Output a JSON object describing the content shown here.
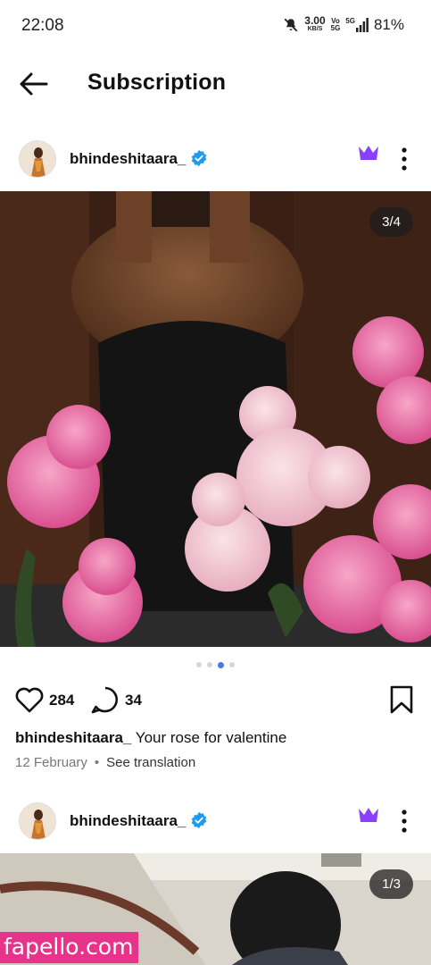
{
  "status_bar": {
    "time": "22:08",
    "speed_value": "3.00",
    "speed_unit": "KB/S",
    "net_small": "Vo\n5G",
    "net_label": "5G",
    "battery": "81%"
  },
  "header": {
    "title": "Subscription"
  },
  "posts": [
    {
      "username": "bhindeshitaara_",
      "image_counter": "3/4",
      "likes": "284",
      "comments": "34",
      "caption_user": "bhindeshitaara_",
      "caption_text": " Your rose for valentine",
      "date": "12 February",
      "translate_label": "See translation"
    },
    {
      "username": "bhindeshitaara_",
      "image_counter": "1/3"
    }
  ],
  "watermark": "fapello.com",
  "colors": {
    "verified": "#1d9bf0",
    "crown": "#8a3ffc",
    "dot_active": "#4a7ae0",
    "watermark_bg": "#e8338a"
  }
}
